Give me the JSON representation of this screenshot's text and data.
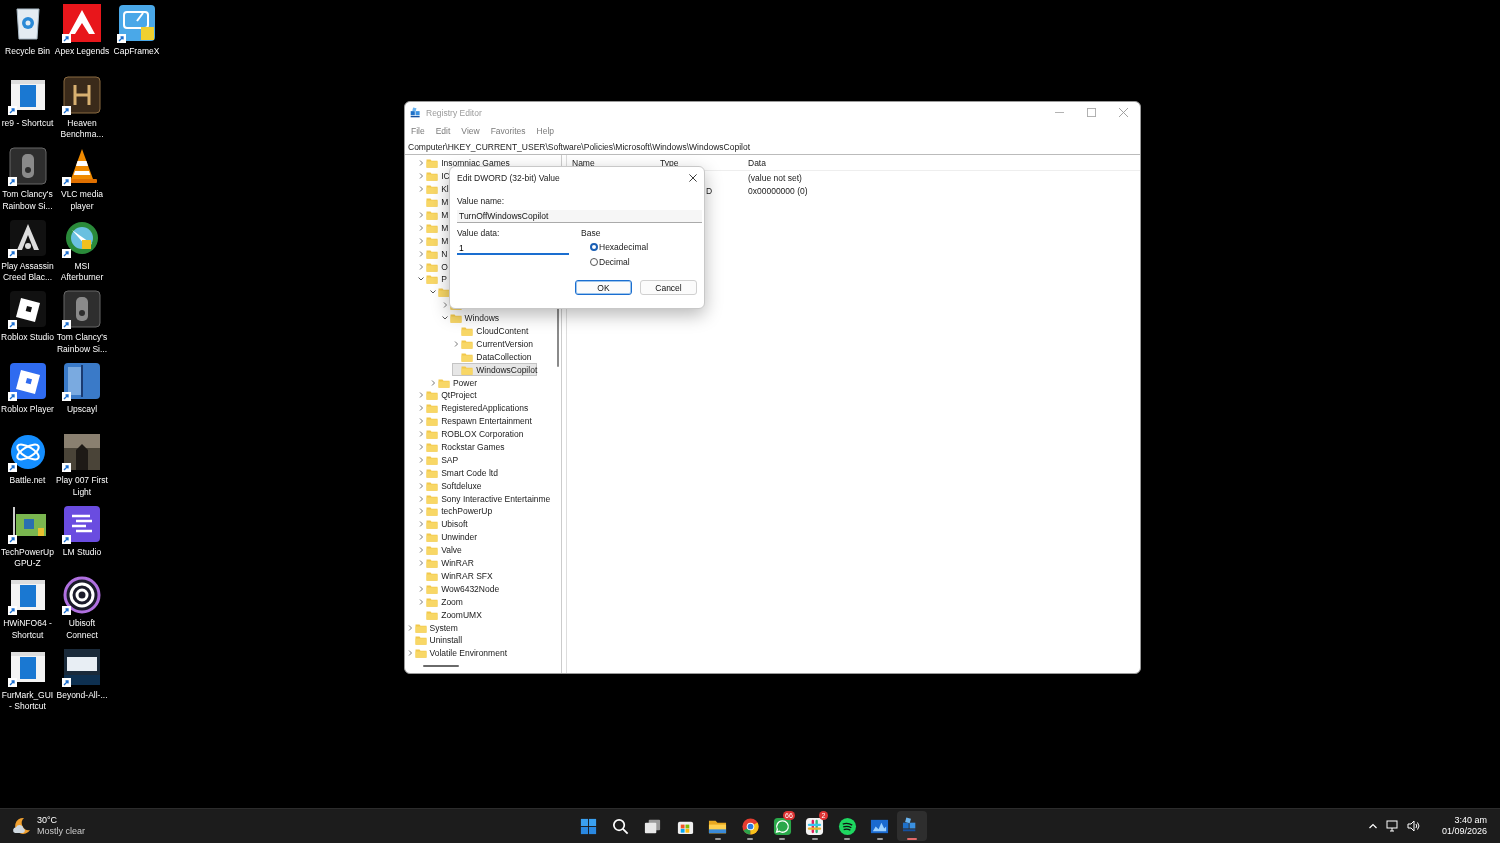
{
  "desktop": {
    "icons": [
      {
        "label": "Recycle Bin",
        "shortcut": false
      },
      {
        "label": "re9 - Shortcut",
        "shortcut": true
      },
      {
        "label": "Tom Clancy's Rainbow Si...",
        "shortcut": true
      },
      {
        "label": "Play Assassin Creed Blac...",
        "shortcut": true
      },
      {
        "label": "Roblox Studio",
        "shortcut": true
      },
      {
        "label": "Roblox Player",
        "shortcut": true
      },
      {
        "label": "Battle.net",
        "shortcut": true
      },
      {
        "label": "TechPowerUp GPU-Z",
        "shortcut": true
      },
      {
        "label": "HWiNFO64 - Shortcut",
        "shortcut": true
      },
      {
        "label": "FurMark_GUI - Shortcut",
        "shortcut": true
      },
      {
        "label": "Apex Legends",
        "shortcut": true
      },
      {
        "label": "Heaven Benchma...",
        "shortcut": true
      },
      {
        "label": "VLC media player",
        "shortcut": true
      },
      {
        "label": "MSI Afterburner",
        "shortcut": true
      },
      {
        "label": "Tom Clancy's Rainbow Si...",
        "shortcut": true
      },
      {
        "label": "Upscayl",
        "shortcut": true
      },
      {
        "label": "Play 007 First Light",
        "shortcut": true
      },
      {
        "label": "LM Studio",
        "shortcut": true
      },
      {
        "label": "Ubisoft Connect",
        "shortcut": true
      },
      {
        "label": "Beyond-All-...",
        "shortcut": true
      },
      {
        "label": "CapFrameX",
        "shortcut": true
      }
    ]
  },
  "window": {
    "title": "Registry Editor",
    "active": false,
    "menu": [
      "File",
      "Edit",
      "View",
      "Favorites",
      "Help"
    ],
    "address": "Computer\\HKEY_CURRENT_USER\\Software\\Policies\\Microsoft\\Windows\\WindowsCopilot",
    "tree": {
      "items": [
        {
          "kind": "offscreen",
          "children": [
            {
              "kind": "branch",
              "label": "Insomniac Games",
              "expanded": false,
              "selected": false
            },
            {
              "kind": "branch",
              "label": "IC",
              "expanded": false,
              "selected": false
            },
            {
              "kind": "branch",
              "label": "Kl",
              "expanded": false,
              "selected": false
            },
            {
              "kind": "leaf",
              "label": "M",
              "selected": false
            },
            {
              "kind": "branch",
              "label": "M",
              "expanded": false,
              "selected": false
            },
            {
              "kind": "branch",
              "label": "M",
              "expanded": false,
              "selected": false
            },
            {
              "kind": "branch",
              "label": "M",
              "expanded": false,
              "selected": false
            },
            {
              "kind": "branch",
              "label": "N",
              "expanded": false,
              "selected": false
            },
            {
              "kind": "branch",
              "label": "O",
              "expanded": false,
              "selected": false
            },
            {
              "kind": "branch",
              "label": "P",
              "expanded": true,
              "selected": false,
              "children": [
                {
                  "kind": "branch",
                  "expanded": true,
                  "selected": false,
                  "children": [
                    {
                      "kind": "branch",
                      "expanded": false,
                      "selected": false
                    },
                    {
                      "kind": "branch",
                      "label": "Windows",
                      "expanded": true,
                      "selected": false,
                      "children": [
                        {
                          "kind": "leaf",
                          "label": "CloudContent",
                          "selected": false
                        },
                        {
                          "kind": "branch",
                          "label": "CurrentVersion",
                          "expanded": false,
                          "selected": false
                        },
                        {
                          "kind": "leaf",
                          "label": "DataCollection",
                          "selected": false
                        },
                        {
                          "kind": "leaf",
                          "label": "WindowsCopilot",
                          "selected": true
                        }
                      ]
                    }
                  ]
                },
                {
                  "kind": "branch",
                  "label": "Power",
                  "expanded": false,
                  "selected": false
                }
              ]
            },
            {
              "kind": "branch",
              "label": "QtProject",
              "expanded": false,
              "selected": false
            },
            {
              "kind": "branch",
              "label": "RegisteredApplications",
              "expanded": false,
              "selected": false
            },
            {
              "kind": "branch",
              "label": "Respawn Entertainment",
              "expanded": false,
              "selected": false
            },
            {
              "kind": "branch",
              "label": "ROBLOX Corporation",
              "expanded": false,
              "selected": false
            },
            {
              "kind": "branch",
              "label": "Rockstar Games",
              "expanded": false,
              "selected": false
            },
            {
              "kind": "branch",
              "label": "SAP",
              "expanded": false,
              "selected": false
            },
            {
              "kind": "branch",
              "label": "Smart Code ltd",
              "expanded": false,
              "selected": false
            },
            {
              "kind": "branch",
              "label": "Softdeluxe",
              "expanded": false,
              "selected": false
            },
            {
              "kind": "branch",
              "label": "Sony Interactive Entertainme",
              "expanded": false,
              "selected": false
            },
            {
              "kind": "branch",
              "label": "techPowerUp",
              "expanded": false,
              "selected": false
            },
            {
              "kind": "branch",
              "label": "Ubisoft",
              "expanded": false,
              "selected": false
            },
            {
              "kind": "branch",
              "label": "Unwinder",
              "expanded": false,
              "selected": false
            },
            {
              "kind": "branch",
              "label": "Valve",
              "expanded": false,
              "selected": false
            },
            {
              "kind": "branch",
              "label": "WinRAR",
              "expanded": false,
              "selected": false
            },
            {
              "kind": "leaf",
              "label": "WinRAR SFX",
              "selected": false
            },
            {
              "kind": "branch",
              "label": "Wow6432Node",
              "expanded": false,
              "selected": false
            },
            {
              "kind": "branch",
              "label": "Zoom",
              "expanded": false,
              "selected": false
            },
            {
              "kind": "leaf",
              "label": "ZoomUMX",
              "selected": false
            }
          ]
        },
        {
          "kind": "branch",
          "label": "System",
          "expanded": false,
          "selected": false
        },
        {
          "kind": "leaf",
          "label": "Uninstall",
          "selected": false
        },
        {
          "kind": "branch",
          "label": "Volatile Environment",
          "expanded": false,
          "selected": false
        }
      ]
    },
    "values": {
      "columns": [
        "Name",
        "Type",
        "Data"
      ],
      "rows": [
        {
          "data": "(value not set)"
        },
        {
          "type": "D",
          "data": "0x00000000 (0)"
        }
      ]
    },
    "dialog": {
      "title": "Edit DWORD (32-bit) Value",
      "value_name": {
        "label": "Value name:",
        "value": "TurnOffWindowsCopilot",
        "focused": false
      },
      "value_data": {
        "label": "Value data:",
        "value": "1",
        "focused": true
      },
      "base": {
        "label": "Base",
        "options": [
          {
            "label": "Hexadecimal",
            "selected": true
          },
          {
            "label": "Decimal",
            "selected": false
          }
        ]
      },
      "buttons": [
        {
          "label": "OK",
          "default": true
        },
        {
          "label": "Cancel",
          "default": false
        }
      ]
    }
  },
  "taskbar": {
    "weather": {
      "temperature": "30°C",
      "condition": "Mostly clear"
    },
    "apps": [
      {
        "running": false,
        "selected": false
      },
      {
        "running": false,
        "selected": false
      },
      {
        "running": false,
        "selected": false
      },
      {
        "running": false,
        "selected": false
      },
      {
        "running": true,
        "selected": false
      },
      {
        "running": true,
        "selected": false
      },
      {
        "running": true,
        "selected": false,
        "badge": "66"
      },
      {
        "running": true,
        "selected": false,
        "badge": "2"
      },
      {
        "running": true,
        "selected": false
      },
      {
        "running": true,
        "selected": false
      },
      {
        "running": true,
        "selected": true
      }
    ],
    "clock": {
      "time": "3:40 am",
      "date": "01/09/2026"
    }
  }
}
